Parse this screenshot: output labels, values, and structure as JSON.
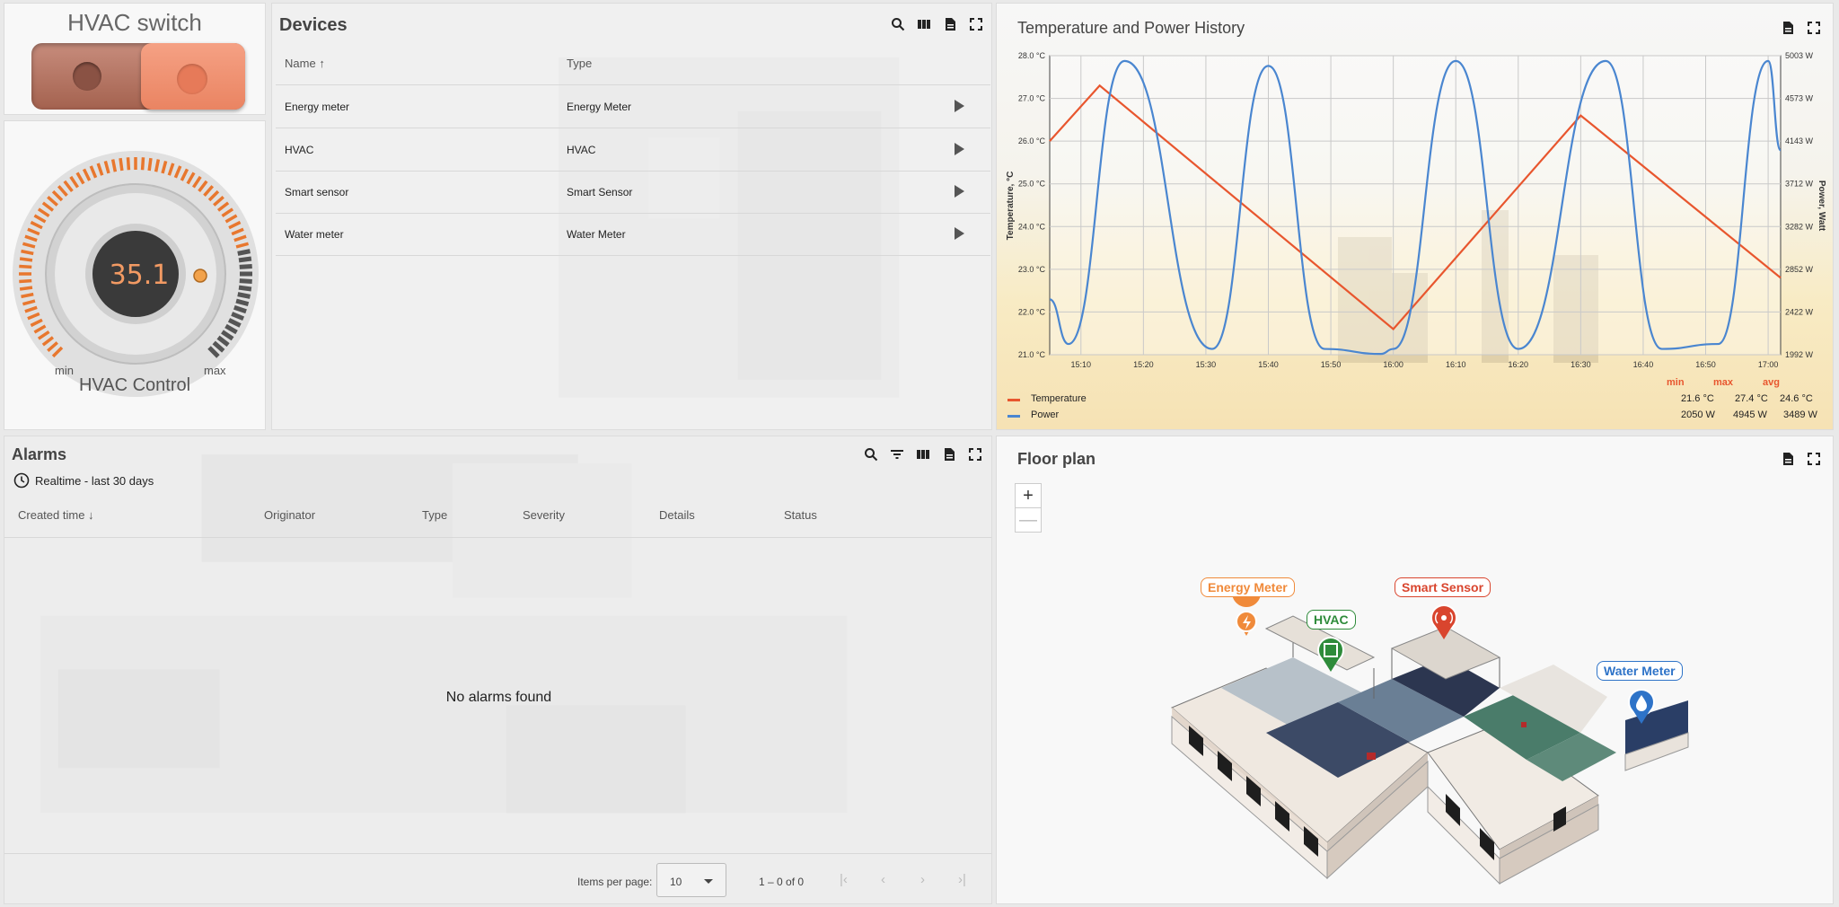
{
  "hvac_switch": {
    "title": "HVAC switch",
    "state": "on"
  },
  "hvac_control": {
    "value": "35.1",
    "min_label": "min",
    "max_label": "max",
    "title": "HVAC Control",
    "level": 0.78
  },
  "devices": {
    "title": "Devices",
    "columns": {
      "name": "Name",
      "type": "Type"
    },
    "rows": [
      {
        "name": "Energy meter",
        "type": "Energy Meter"
      },
      {
        "name": "HVAC",
        "type": "HVAC"
      },
      {
        "name": "Smart sensor",
        "type": "Smart Sensor"
      },
      {
        "name": "Water meter",
        "type": "Water Meter"
      }
    ]
  },
  "chart": {
    "title": "Temperature and Power History"
  },
  "chart_data": {
    "type": "line",
    "title": "Temperature and Power History",
    "ylabel": "Temperature, °C",
    "y2label": "Power, Watt",
    "ylim": [
      21.0,
      28.0
    ],
    "y2lim": [
      1992,
      5003
    ],
    "y_ticks": [
      "28.0 °C",
      "27.0 °C",
      "26.0 °C",
      "25.0 °C",
      "24.0 °C",
      "23.0 °C",
      "22.0 °C",
      "21.0 °C"
    ],
    "y2_ticks": [
      "5003 W",
      "4573 W",
      "4143 W",
      "3712 W",
      "3282 W",
      "2852 W",
      "2422 W",
      "1992 W"
    ],
    "x_ticks": [
      "15:10",
      "15:20",
      "15:30",
      "15:40",
      "15:50",
      "16:00",
      "16:10",
      "16:20",
      "16:30",
      "16:40",
      "16:50",
      "17:00"
    ],
    "grid": true,
    "series": [
      {
        "name": "Temperature",
        "color": "#e8562e",
        "unit": "°C",
        "x": [
          "15:05",
          "15:13",
          "16:00",
          "16:30",
          "17:02"
        ],
        "values": [
          26.0,
          27.3,
          21.6,
          26.6,
          22.8
        ]
      },
      {
        "name": "Power",
        "color": "#4a86d0",
        "unit": "W",
        "x": [
          "15:05",
          "15:08",
          "15:17",
          "15:31",
          "15:40",
          "15:49",
          "15:58",
          "16:00",
          "16:10",
          "16:20",
          "16:34",
          "16:43",
          "16:52",
          "17:00",
          "17:02"
        ],
        "values": [
          2550,
          2100,
          4950,
          2050,
          4900,
          2050,
          2000,
          2050,
          4950,
          2050,
          4950,
          2050,
          2100,
          4950,
          4050
        ]
      }
    ],
    "legend": {
      "headers": [
        "min",
        "max",
        "avg"
      ],
      "rows": [
        {
          "name": "Temperature",
          "min": "21.6 °C",
          "max": "27.4 °C",
          "avg": "24.6 °C"
        },
        {
          "name": "Power",
          "min": "2050 W",
          "max": "4945 W",
          "avg": "3489 W"
        }
      ]
    }
  },
  "alarms": {
    "title": "Alarms",
    "realtime": "Realtime - last 30 days",
    "columns": {
      "created": "Created time",
      "originator": "Originator",
      "type": "Type",
      "severity": "Severity",
      "details": "Details",
      "status": "Status"
    },
    "empty": "No alarms found",
    "items_per_page_label": "Items per page:",
    "items_per_page": "10",
    "page_info": "1 – 0 of 0"
  },
  "floor_plan": {
    "title": "Floor plan",
    "zoom_in": "+",
    "zoom_out": "—",
    "markers": [
      {
        "label": "Energy Meter",
        "color": "#f08a3a"
      },
      {
        "label": "HVAC",
        "color": "#2e8b3a"
      },
      {
        "label": "Smart Sensor",
        "color": "#d9452e"
      },
      {
        "label": "Water Meter",
        "color": "#2e73c8"
      }
    ]
  }
}
